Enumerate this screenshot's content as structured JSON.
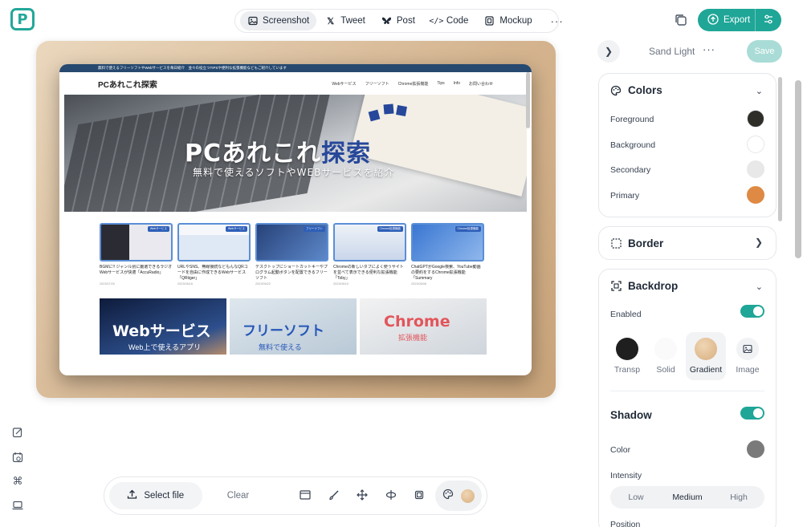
{
  "app": {
    "logo_letter": "P"
  },
  "topnav": {
    "tabs": [
      {
        "label": "Screenshot",
        "icon": "image-icon",
        "active": true
      },
      {
        "label": "Tweet",
        "icon": "x-icon"
      },
      {
        "label": "Post",
        "icon": "butterfly-icon"
      },
      {
        "label": "Code",
        "icon": "code-icon"
      },
      {
        "label": "Mockup",
        "icon": "device-icon"
      }
    ],
    "more": "···"
  },
  "export": {
    "label": "Export"
  },
  "preview": {
    "topline": "無料で使えるフリーソフトやWebサービスを毎日紹介　並々の役立つTIPSや便利な拡張機能などもご紹介しています",
    "site_title": "PCあれこれ探索",
    "menu": [
      "Webサービス",
      "フリーソフト",
      "Chrome拡張機能",
      "Tips",
      "Info",
      "お問い合わせ"
    ],
    "hero_title_main": "PCあれこれ",
    "hero_title_accent": "探索",
    "hero_sub": "無料で使えるソフトやWEBサービスを紹介",
    "cards": [
      {
        "tag": "Webサービス",
        "title": "BGMに!! ジャンル別に厳選できるラジオWebサービスが快適「AccuRadio」",
        "date": "2023/07/20"
      },
      {
        "tag": "Webサービス",
        "title": "URLやSNS、無線接続などもんなQRコードを自由に作成できるWebサービス「QRtiger」",
        "date": "2023/06/16"
      },
      {
        "tag": "フリーソフト",
        "title": "デスクトップにショートカットキーやプログラム起動ボタンを配置できるフリーソフト",
        "date": "2023/06/22"
      },
      {
        "tag": "Chrome拡張機能",
        "title": "Chromeの新しいタブによく使うサイトを並べて表示できる便利な拡張機能「Toby」",
        "date": "2023/06/10"
      },
      {
        "tag": "Chrome拡張機能",
        "title": "ChatGPTがGoogle検索、YouTube動画の要約をするChrome拡張機能「Summary",
        "date": "2023/06/08"
      }
    ],
    "tiles": [
      {
        "big": "Webサービス",
        "small": "Web上で使えるアプリ"
      },
      {
        "big": "フリーソフト",
        "small": "無料で使える"
      },
      {
        "big": "Chrome",
        "small": "拡張機能"
      }
    ]
  },
  "bottombar": {
    "select_file": "Select file",
    "clear": "Clear"
  },
  "panel": {
    "theme_name": "Sand Light",
    "more": "···",
    "save": "Save",
    "colors": {
      "title": "Colors",
      "rows": [
        {
          "label": "Foreground",
          "color": "#2f2d28"
        },
        {
          "label": "Background",
          "color": "#ffffff"
        },
        {
          "label": "Secondary",
          "color": "#e8e8e8"
        },
        {
          "label": "Primary",
          "color": "#de8a44"
        }
      ]
    },
    "border": {
      "title": "Border"
    },
    "backdrop": {
      "title": "Backdrop",
      "enabled_label": "Enabled",
      "enabled": true,
      "options": [
        {
          "label": "Transp",
          "active": false
        },
        {
          "label": "Solid",
          "active": false
        },
        {
          "label": "Gradient",
          "active": true
        },
        {
          "label": "Image",
          "active": false
        }
      ]
    },
    "shadow": {
      "title": "Shadow",
      "enabled": true,
      "color_label": "Color",
      "color": "#7a7a7a",
      "intensity_label": "Intensity",
      "intensity_options": [
        "Low",
        "Medium",
        "High"
      ],
      "intensity_selected": "Medium",
      "position_label": "Position"
    }
  }
}
